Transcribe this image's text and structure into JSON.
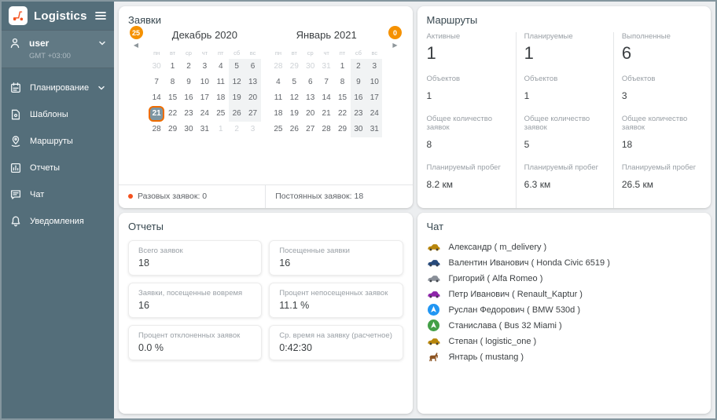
{
  "colors": {
    "accent_orange": "#f59100",
    "selected_day_border": "#ef6c00",
    "selected_day_fill": "#7d96a3",
    "sidebar_bg": "#546e7a",
    "bullet_orange": "#f4511e"
  },
  "sidebar": {
    "brand": "Logistics",
    "logo_icon": "scooter-icon",
    "menu_toggle_icon": "hamburger-icon",
    "user": {
      "name": "user",
      "timezone": "GMT +03:00"
    },
    "items": [
      {
        "label": "Планирование",
        "icon": "planning-icon",
        "chevron": true
      },
      {
        "label": "Шаблоны",
        "icon": "templates-icon",
        "chevron": false
      },
      {
        "label": "Маршруты",
        "icon": "routes-icon",
        "chevron": false
      },
      {
        "label": "Отчеты",
        "icon": "reports-icon",
        "chevron": false
      },
      {
        "label": "Чат",
        "icon": "chat-icon",
        "chevron": false
      },
      {
        "label": "Уведомления",
        "icon": "notifications-icon",
        "chevron": false
      }
    ]
  },
  "requests": {
    "title": "Заявки",
    "prev_badge": "25",
    "next_badge": "0",
    "prev_arrow": "◀",
    "next_arrow": "▶",
    "weekdays": [
      "пн",
      "вт",
      "ср",
      "чт",
      "пт",
      "сб",
      "вс"
    ],
    "calendars": [
      {
        "title": "Декабрь 2020",
        "weeks": [
          [
            "30m",
            "1",
            "2",
            "3",
            "4",
            "5",
            "6"
          ],
          [
            "7",
            "8",
            "9",
            "10",
            "11",
            "12",
            "13"
          ],
          [
            "14",
            "15",
            "16",
            "17",
            "18",
            "19",
            "20"
          ],
          [
            "21s",
            "22",
            "23",
            "24",
            "25",
            "26",
            "27"
          ],
          [
            "28",
            "29",
            "30",
            "31",
            "1m",
            "2m",
            "3m"
          ]
        ]
      },
      {
        "title": "Январь 2021",
        "weeks": [
          [
            "28m",
            "29m",
            "30m",
            "31m",
            "1",
            "2",
            "3"
          ],
          [
            "4",
            "5",
            "6",
            "7",
            "8",
            "9",
            "10"
          ],
          [
            "11",
            "12",
            "13",
            "14",
            "15",
            "16",
            "17"
          ],
          [
            "18",
            "19",
            "20",
            "21",
            "22",
            "23",
            "24"
          ],
          [
            "25",
            "26",
            "27",
            "28",
            "29",
            "30",
            "31"
          ]
        ]
      }
    ],
    "footer": [
      {
        "label": "Разовых заявок: 0",
        "dot": true
      },
      {
        "label": "Постоянных заявок: 18",
        "dot": false
      }
    ]
  },
  "routes": {
    "title": "Маршруты",
    "columns": [
      {
        "status": "Активные",
        "count": "1",
        "stats": [
          {
            "label": "Объектов",
            "value": "1"
          },
          {
            "label": "Общее количество заявок",
            "value": "8"
          },
          {
            "label": "Планируемый пробег",
            "value": "8.2 км"
          }
        ]
      },
      {
        "status": "Планируемые",
        "count": "1",
        "stats": [
          {
            "label": "Объектов",
            "value": "1"
          },
          {
            "label": "Общее количество заявок",
            "value": "5"
          },
          {
            "label": "Планируемый пробег",
            "value": "6.3 км"
          }
        ]
      },
      {
        "status": "Выполненные",
        "count": "6",
        "stats": [
          {
            "label": "Объектов",
            "value": "3"
          },
          {
            "label": "Общее количество заявок",
            "value": "18"
          },
          {
            "label": "Планируемый пробег",
            "value": "26.5 км"
          }
        ]
      }
    ]
  },
  "reports": {
    "title": "Отчеты",
    "cards": [
      {
        "label": "Всего заявок",
        "value": "18"
      },
      {
        "label": "Посещенные заявки",
        "value": "16"
      },
      {
        "label": "Заявки, посещенные вовремя",
        "value": "16"
      },
      {
        "label": "Процент непосещенных заявок",
        "value": "11.1 %"
      },
      {
        "label": "Процент отклоненных заявок",
        "value": "0.0 %"
      },
      {
        "label": "Ср. время на заявку (расчетное)",
        "value": "0:42:30"
      }
    ]
  },
  "chat": {
    "title": "Чат",
    "contacts": [
      {
        "name": "Александр ( m_delivery )",
        "icon": "car-icon",
        "color": "#b8860b"
      },
      {
        "name": "Валентин Иванович ( Honda Civic 6519 )",
        "icon": "car-icon",
        "color": "#274a7c"
      },
      {
        "name": "Григорий ( Alfa Romeo )",
        "icon": "car-icon",
        "color": "#8a9099"
      },
      {
        "name": "Петр Иванович ( Renault_Kaptur )",
        "icon": "car-icon",
        "color": "#8e24aa"
      },
      {
        "name": "Руслан Федорович ( BMW 530d )",
        "icon": "nav-arrow-icon",
        "color": "#2196f3"
      },
      {
        "name": "Станислава ( Bus 32 Miami )",
        "icon": "nav-arrow-icon",
        "color": "#43a047"
      },
      {
        "name": "Степан ( logistic_one )",
        "icon": "car-icon",
        "color": "#b8860b"
      },
      {
        "name": "Янтарь ( mustang )",
        "icon": "horse-icon",
        "color": "#8d5524"
      }
    ]
  }
}
